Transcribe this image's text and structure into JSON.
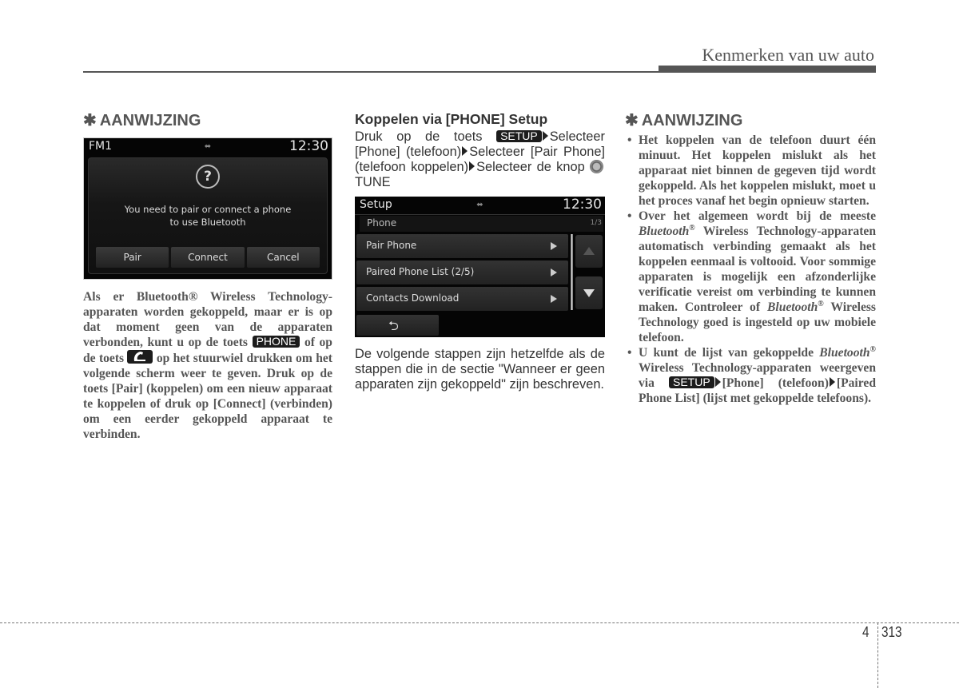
{
  "header": {
    "section_title": "Kenmerken van uw auto"
  },
  "col1": {
    "note_star": "✱",
    "note_title": "AANWIJZING",
    "screen": {
      "source": "FM1",
      "usb_icon": "usb-icon",
      "clock": "12:30",
      "question_glyph": "?",
      "message_line1": "You need to pair or connect a phone",
      "message_line2": "to use Bluetooth",
      "buttons": [
        "Pair",
        "Connect",
        "Cancel"
      ]
    },
    "para": {
      "t1": "Als er Bluetooth® Wireless Technology-apparaten worden gekoppeld, maar er is op dat moment geen van de apparaten verbonden, kunt u op de toets ",
      "key_phone": "PHONE",
      "t2": " of op de toets ",
      "t3": " op het stuurwiel drukken om het volgende scherm weer te geven. Druk op de toets [Pair] (koppelen) om een nieuw apparaat te koppelen of druk op [Connect] (verbinden) om een eerder gekoppeld apparaat te verbinden."
    }
  },
  "col2": {
    "heading": "Koppelen via [PHONE] Setup",
    "steps": {
      "t1": "Druk op de toets ",
      "key_setup": "SETUP",
      "t2": "Selecteer [Phone] (telefoon)",
      "t3": "Selecteer [Pair Phone] (telefoon koppelen)",
      "t4": "Selecteer de knop ",
      "t5": " TUNE"
    },
    "screen": {
      "title": "Setup",
      "usb_icon": "usb-icon",
      "clock": "12:30",
      "subtitle": "Phone",
      "page_indicator": "1/3",
      "items": [
        "Pair Phone",
        "Paired Phone List (2/5)",
        "Contacts Download"
      ],
      "back_glyph": "⮌"
    },
    "para": "De volgende stappen zijn hetzelfde als de stappen die in de sectie \"Wanneer er geen apparaten zijn gekoppeld\" zijn beschreven."
  },
  "col3": {
    "note_star": "✱",
    "note_title": "AANWIJZING",
    "bullet_glyph": "•",
    "bullets": [
      {
        "text": "Het koppelen van de telefoon duurt één minuut. Het koppelen mislukt als het apparaat niet binnen de gegeven tijd wordt gekoppeld. Als het koppelen mislukt, moet u het proces vanaf het begin opnieuw starten."
      },
      {
        "t1": "Over het algemeen wordt bij de meeste ",
        "brand": "Bluetooth",
        "reg": "®",
        "t2": " Wireless Technology-apparaten automatisch verbinding gemaakt als het koppelen eenmaal is voltooid. Voor sommige apparaten is mogelijk een afzonderlijke verificatie vereist om verbinding te kunnen maken. Controleer of ",
        "t3": " Wireless Technology goed is ingesteld op uw mobiele telefoon."
      },
      {
        "t1": "U kunt de lijst van gekoppelde ",
        "brand": "Bluetooth",
        "reg": "®",
        "t2": " Wireless Technology-apparaten weergeven via ",
        "key_setup": "SETUP",
        "t3": "[Phone] (telefoon)",
        "t4": "[Paired Phone List] (lijst met gekoppelde telefoons)."
      }
    ]
  },
  "footer": {
    "chapter": "4",
    "page": "313"
  }
}
